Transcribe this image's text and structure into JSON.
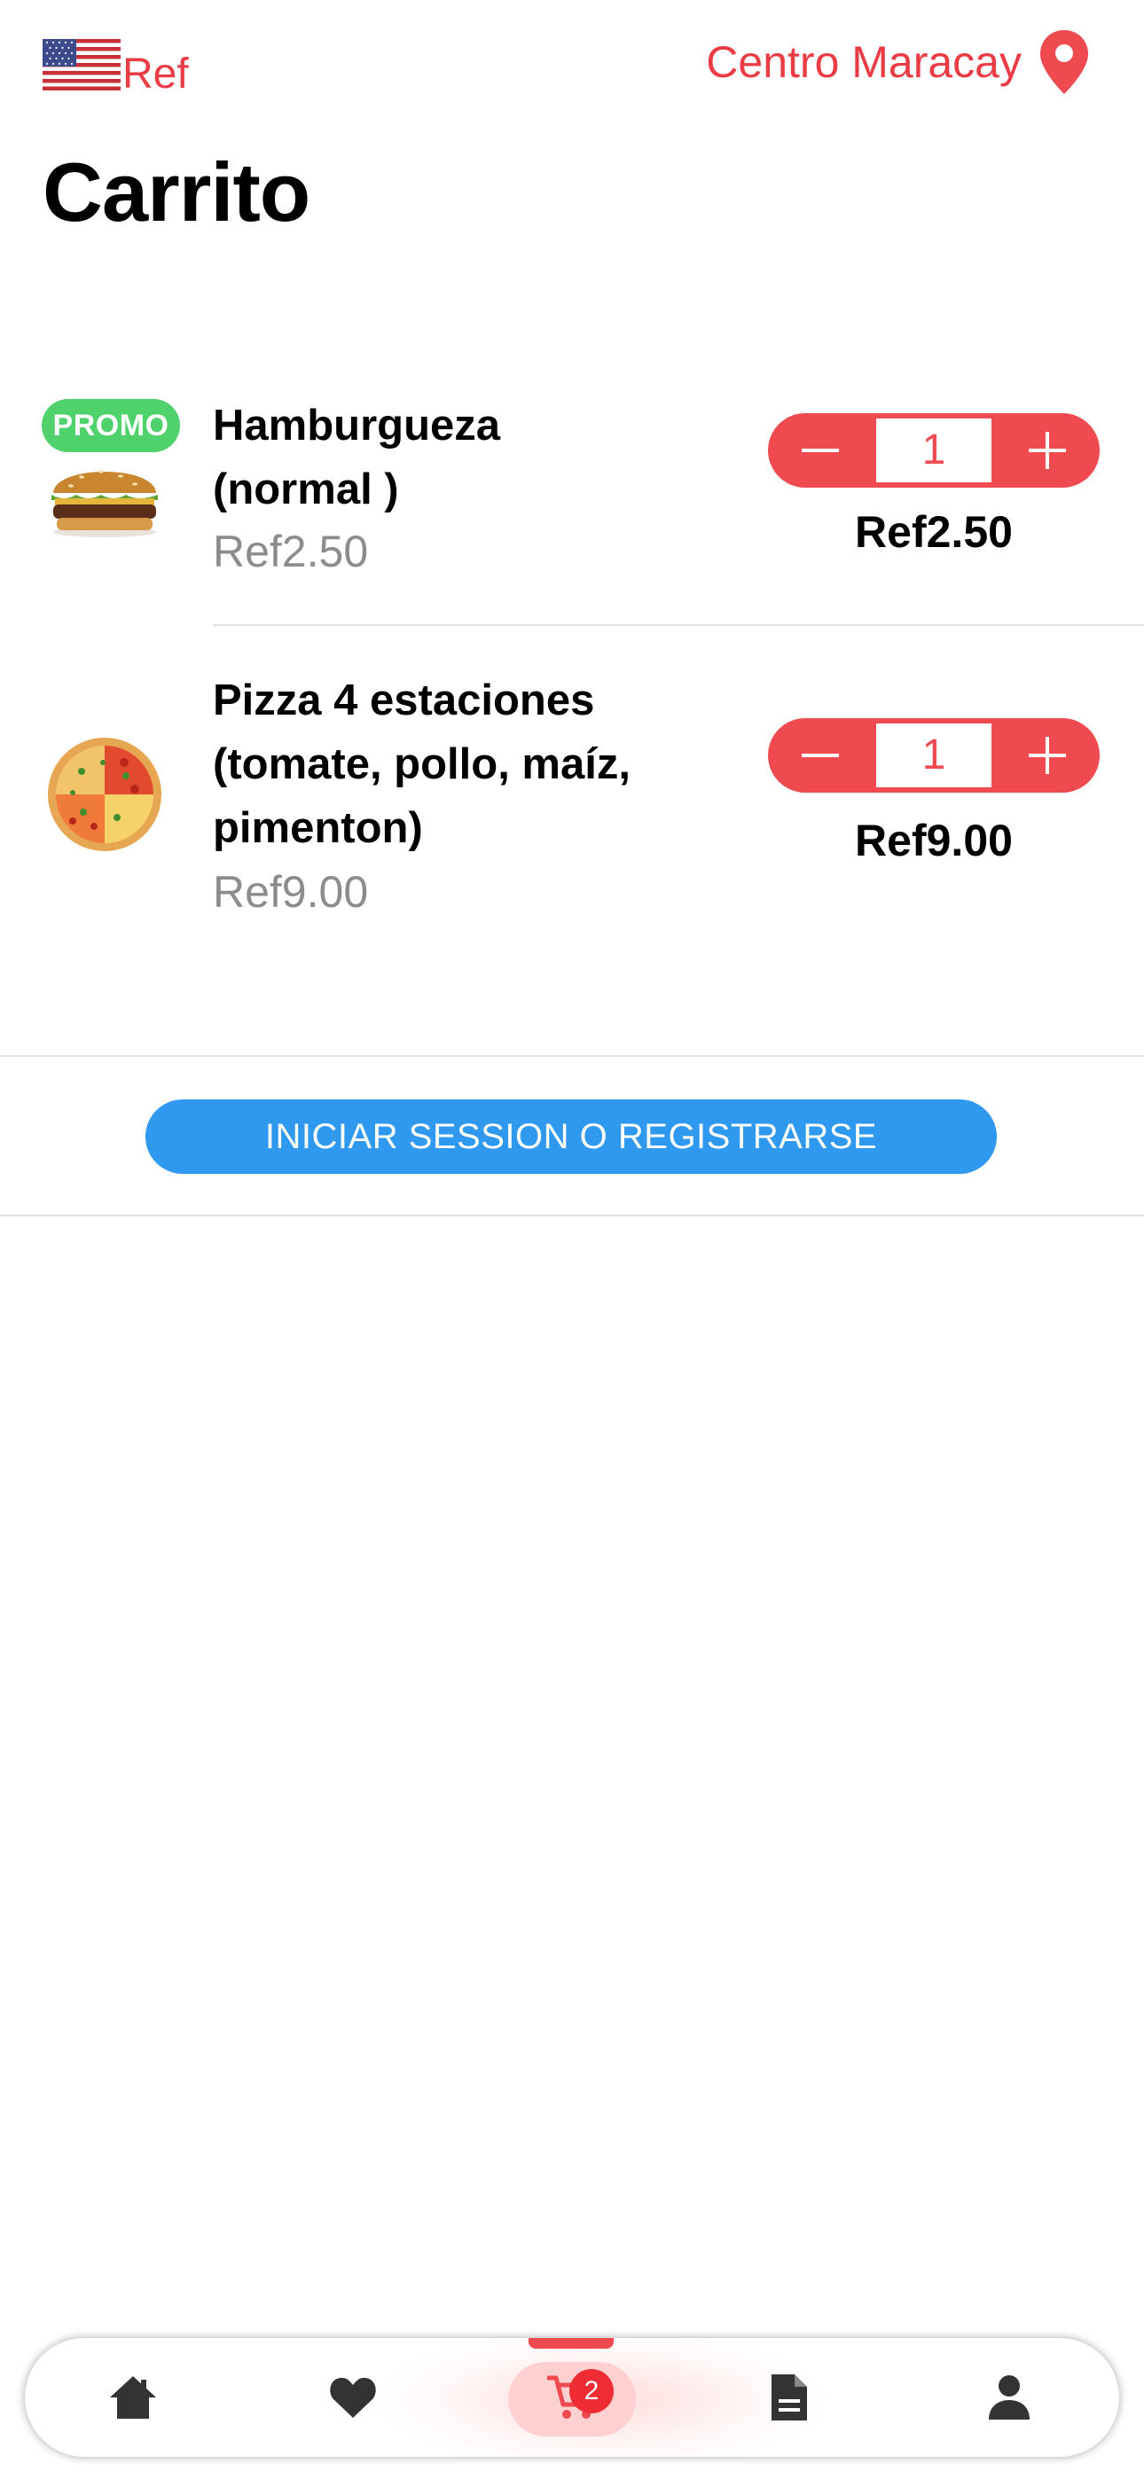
{
  "header": {
    "currency_label": "Ref",
    "location_label": "Centro Maracay",
    "flag_icon": "us-flag-icon",
    "location_icon": "map-pin-icon",
    "accent_color": "#ea3c44"
  },
  "page": {
    "title": "Carrito"
  },
  "cart": {
    "items": [
      {
        "name_line1": "Hamburgueza",
        "name_line2": "(normal )",
        "unit_price": "Ref2.50",
        "quantity": "1",
        "line_total": "Ref2.50",
        "badge": "PROMO"
      },
      {
        "name_line1": "Pizza 4 estaciones",
        "name_line2": "(tomate, pollo, maíz,",
        "name_line3": "pimenton)",
        "unit_price": "Ref9.00",
        "quantity": "1",
        "line_total": "Ref9.00"
      }
    ]
  },
  "login_button": {
    "label": "INICIAR SESSION O REGISTRARSE",
    "color": "#2f98ef"
  },
  "bottom_nav": {
    "items": [
      "home-icon",
      "heart-icon",
      "cart-icon",
      "document-icon",
      "user-icon"
    ],
    "active": "cart-icon",
    "cart_count": "2"
  }
}
